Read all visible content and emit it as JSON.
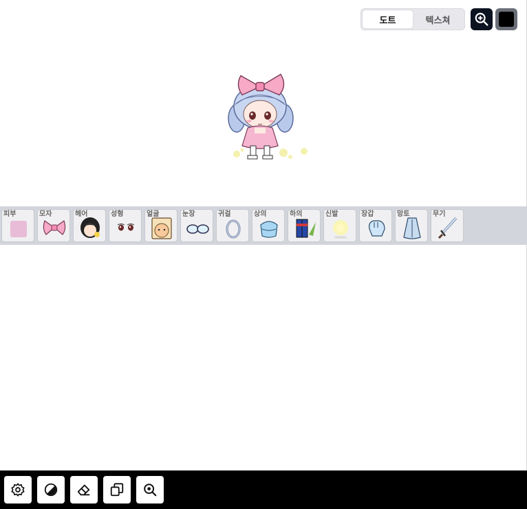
{
  "mode_toggle": {
    "dot_label": "도트",
    "texture_label": "텍스쳐",
    "active": "dot"
  },
  "preview": {
    "zoom_icon": "zoom-in-icon",
    "background_color": "#000000"
  },
  "equipment_slots": [
    {
      "label": "피부",
      "icon": "skin-swatch-icon"
    },
    {
      "label": "모자",
      "icon": "pink-ribbon-icon"
    },
    {
      "label": "헤어",
      "icon": "hair-icon"
    },
    {
      "label": "성형",
      "icon": "face-eyes-icon"
    },
    {
      "label": "얼굴",
      "icon": "face-accessory-icon"
    },
    {
      "label": "눈장",
      "icon": "glasses-icon"
    },
    {
      "label": "귀걸",
      "icon": "earring-icon"
    },
    {
      "label": "상의",
      "icon": "top-icon"
    },
    {
      "label": "하의",
      "icon": "bottom-icon"
    },
    {
      "label": "신발",
      "icon": "shoes-icon"
    },
    {
      "label": "장갑",
      "icon": "glove-icon"
    },
    {
      "label": "망토",
      "icon": "cape-icon"
    },
    {
      "label": "무기",
      "icon": "sword-icon"
    }
  ],
  "toolbar": [
    {
      "icon": "settings-icon"
    },
    {
      "icon": "contrast-icon"
    },
    {
      "icon": "eraser-icon"
    },
    {
      "icon": "copy-icon"
    },
    {
      "icon": "search-zoom-icon"
    }
  ],
  "colors": {
    "skin_swatch": "#e8bcd6",
    "equip_bar": "#d3d5dc",
    "toolbar_bg": "#000000"
  }
}
